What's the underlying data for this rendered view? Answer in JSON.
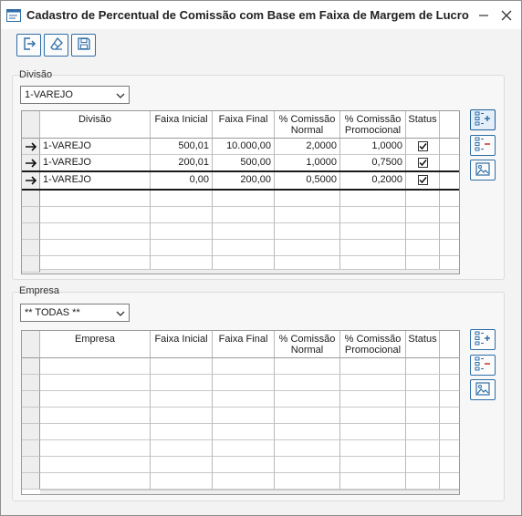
{
  "window": {
    "title": "Cadastro de Percentual de Comissão com Base em Faixa de Margem de Lucro"
  },
  "toolbar": {
    "exit": "exit-icon",
    "clear": "eraser-icon",
    "save": "save-icon"
  },
  "divisao": {
    "group_label": "Divisão",
    "select_value": "1-VAREJO",
    "columns": [
      "Divisão",
      "Faixa Inicial",
      "Faixa Final",
      "% Comissão Normal",
      "% Comissão Promocional",
      "Status"
    ],
    "rows": [
      {
        "divisao": "1-VAREJO",
        "faixa_inicial": "500,01",
        "faixa_final": "10.000,00",
        "comissao_normal": "2,0000",
        "comissao_promocional": "1,0000",
        "status": true
      },
      {
        "divisao": "1-VAREJO",
        "faixa_inicial": "200,01",
        "faixa_final": "500,00",
        "comissao_normal": "1,0000",
        "comissao_promocional": "0,7500",
        "status": true
      },
      {
        "divisao": "1-VAREJO",
        "faixa_inicial": "0,00",
        "faixa_final": "200,00",
        "comissao_normal": "0,5000",
        "comissao_promocional": "0,2000",
        "status": true
      }
    ]
  },
  "empresa": {
    "group_label": "Empresa",
    "select_value": "** TODAS **",
    "columns": [
      "Empresa",
      "Faixa Inicial",
      "Faixa Final",
      "% Comissão Normal",
      "% Comissão Promocional",
      "Status"
    ],
    "rows": []
  },
  "side_buttons": [
    "add-row-icon",
    "remove-row-icon",
    "image-icon"
  ],
  "colors": {
    "accent": "#2e6ea7"
  }
}
